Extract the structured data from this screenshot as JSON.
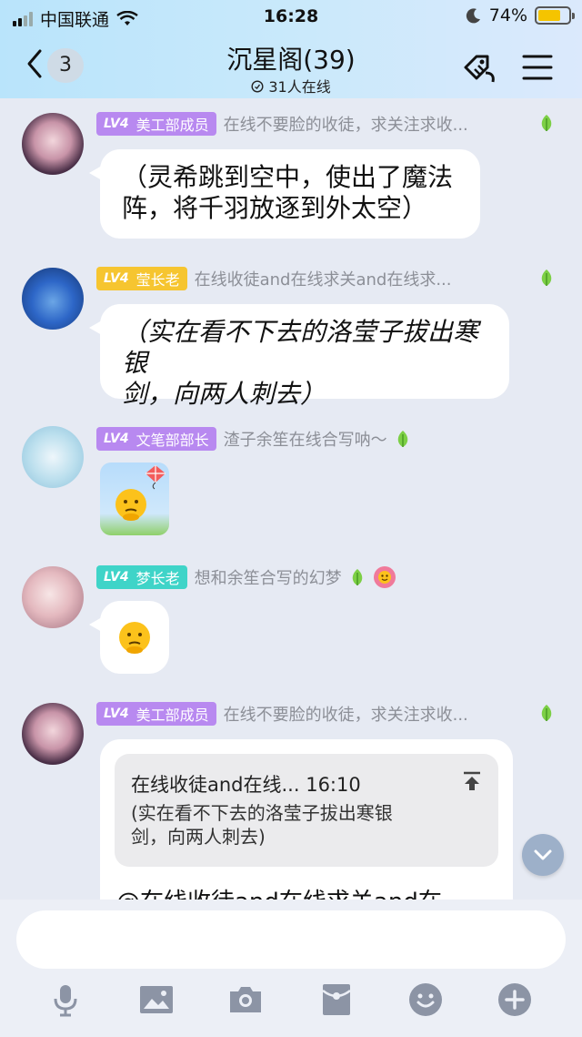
{
  "status_bar": {
    "carrier": "中国联通",
    "time": "16:28",
    "battery_percent": "74%",
    "battery_level": 0.74,
    "battery_color": "#f5c400"
  },
  "header": {
    "back_count": "3",
    "title": "沉星阁(39)",
    "online_text": "31人在线",
    "icons": [
      "back-chevron-icon",
      "clock-icon",
      "tag-icon",
      "menu-icon"
    ]
  },
  "messages": [
    {
      "type": "text",
      "level": "LV4",
      "title": "美工部成员",
      "badge_color": "#b889f0",
      "username": "在线不要脸的收徒，求关注求收...",
      "text_lines": [
        "（灵希跳到空中，使出了魔法",
        "阵，将千羽放逐到外太空）"
      ]
    },
    {
      "type": "text",
      "level": "LV4",
      "title": "莹长老",
      "badge_color": "#f6c530",
      "username": "在线收徒and在线求关and在线求...",
      "text_lines": [
        "（实在看不下去的洛莹子拔出寒银",
        "剑，向两人刺去）"
      ]
    },
    {
      "type": "sticker",
      "level": "LV4",
      "title": "文笔部部长",
      "badge_color": "#b889f0",
      "username": "渣子余笙在线合写呐～",
      "sticker": "kite-sticker"
    },
    {
      "type": "emoji",
      "level": "LV4",
      "title": "梦长老",
      "badge_color": "#3fd4c8",
      "username": "想和余笙合写的幻梦",
      "emoji": "thinking-face-icon"
    },
    {
      "type": "reply",
      "level": "LV4",
      "title": "美工部成员",
      "badge_color": "#b889f0",
      "username": "在线不要脸的收徒，求关注求收...",
      "quote_header": "在线收徒and在线... 16:10",
      "quote_lines": [
        "(实在看不下去的洛莹子拔出寒银",
        "剑，向两人刺去)"
      ],
      "reply_text": "@在线收徒and在线求关and在..."
    }
  ],
  "input": {
    "placeholder": ""
  },
  "toolbar": {
    "icons": [
      "microphone-icon",
      "image-icon",
      "camera-icon",
      "red-packet-icon",
      "emoji-icon",
      "plus-icon"
    ]
  }
}
